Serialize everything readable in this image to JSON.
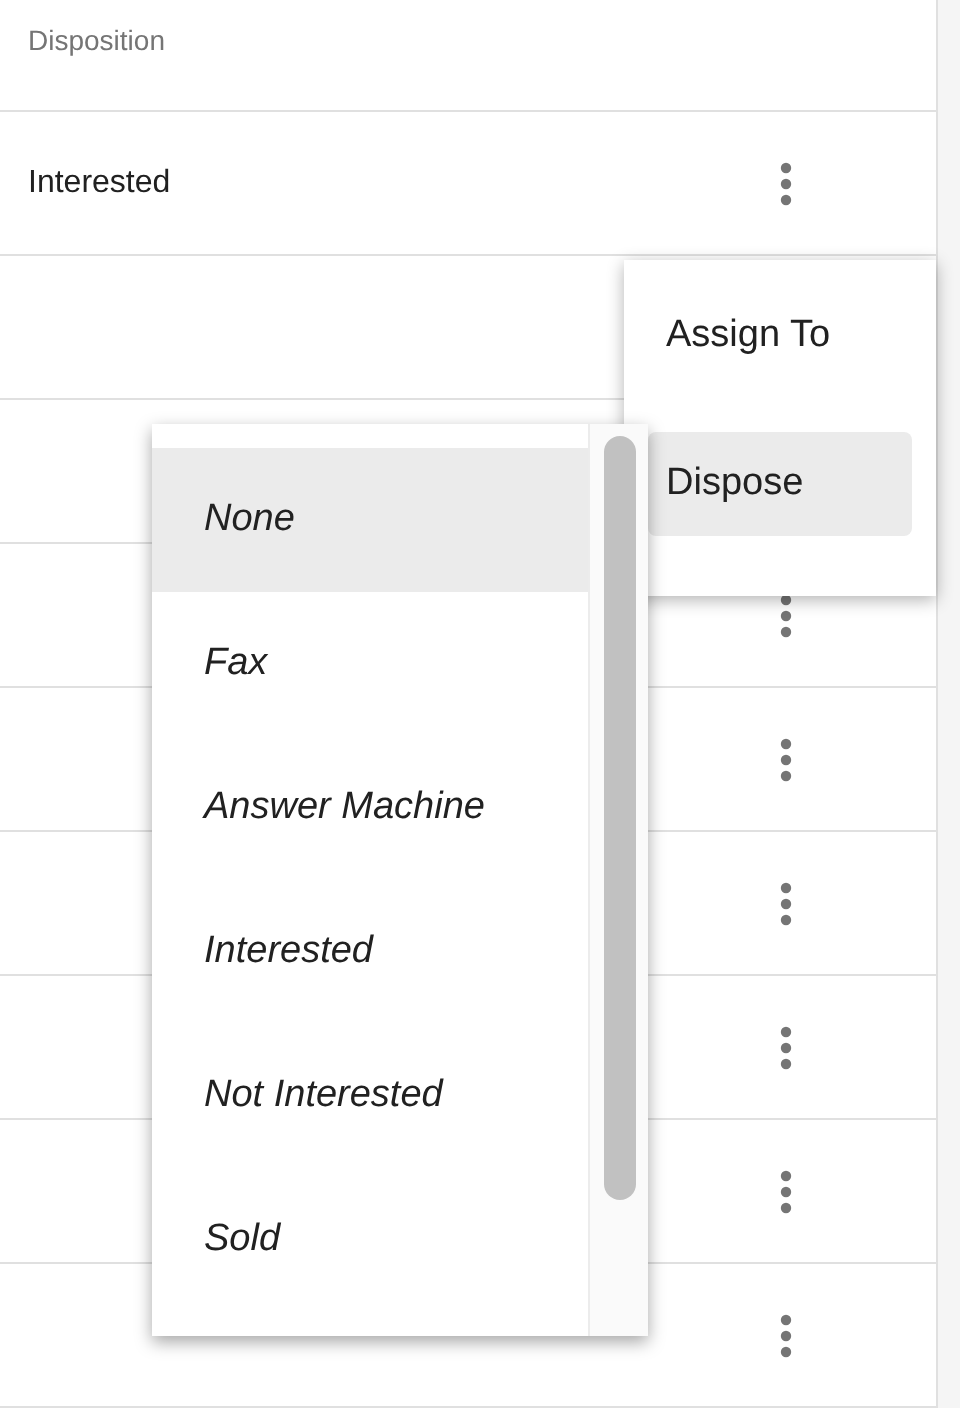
{
  "table": {
    "columns": [
      "Disposition"
    ],
    "rows": [
      {
        "disposition": "Interested",
        "actions_visible": true
      },
      {
        "actions_visible": false
      },
      {
        "actions_visible": false
      },
      {
        "actions_visible": true
      },
      {
        "actions_visible": true
      },
      {
        "actions_visible": true
      },
      {
        "actions_visible": true
      },
      {
        "actions_visible": true
      },
      {
        "actions_visible": true
      }
    ]
  },
  "context_menu": {
    "items": [
      {
        "label": "Assign To",
        "selected": false
      },
      {
        "label": "Dispose",
        "selected": true
      }
    ]
  },
  "disposition_dropdown": {
    "options": [
      {
        "label": "None",
        "selected": true
      },
      {
        "label": "Fax",
        "selected": false
      },
      {
        "label": "Answer Machine",
        "selected": false
      },
      {
        "label": "Interested",
        "selected": false
      },
      {
        "label": "Not Interested",
        "selected": false
      },
      {
        "label": "Sold",
        "selected": false
      }
    ]
  }
}
